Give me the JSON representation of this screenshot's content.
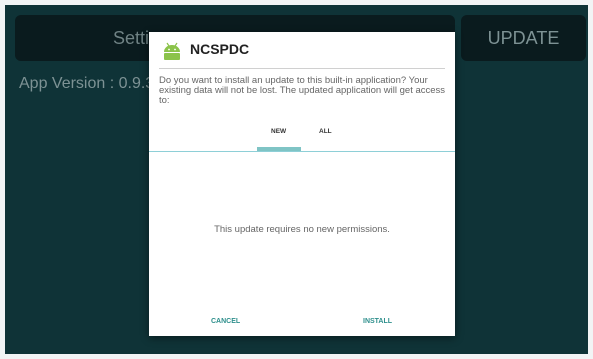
{
  "background_app": {
    "settings_button_label": "Setti",
    "update_button_label": "UPDATE",
    "app_version_text": "App Version : 0.9.3"
  },
  "dialog": {
    "icon": "android-icon",
    "title": "NCSPDC",
    "message": "Do you want to install an update to this built-in application? Your existing data will not be lost. The updated application will get access to:",
    "tabs": [
      {
        "label": "NEW",
        "selected": true
      },
      {
        "label": "ALL",
        "selected": false
      }
    ],
    "body_text": "This update requires no new permissions.",
    "cancel_label": "CANCEL",
    "install_label": "INSTALL"
  },
  "colors": {
    "app_background": "#0f3337",
    "button_background": "#0a1b1e",
    "accent": "#2e8f8c",
    "tab_indicator": "#7fc4c5",
    "android_green": "#8bc34a"
  }
}
